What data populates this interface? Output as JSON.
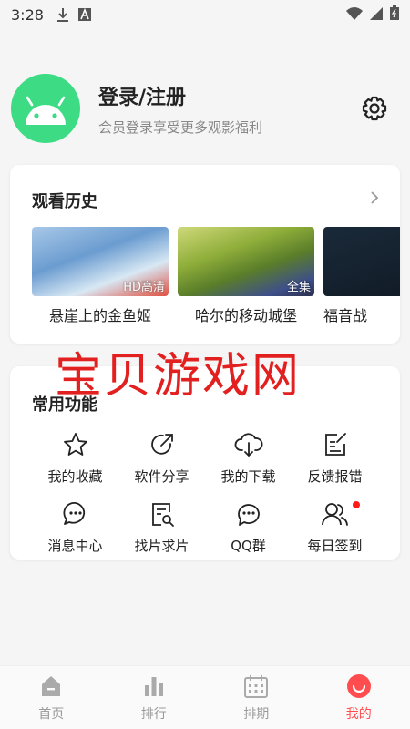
{
  "status_bar": {
    "time": "3:28"
  },
  "profile": {
    "title": "登录/注册",
    "subtitle": "会员登录享受更多观影福利"
  },
  "history": {
    "title": "观看历史",
    "items": [
      {
        "name": "悬崖上的金鱼姬",
        "badge": "HD高清"
      },
      {
        "name": "哈尔的移动城堡",
        "badge": "全集"
      },
      {
        "name": "福音战",
        "badge": ""
      }
    ]
  },
  "watermark": "宝贝游戏网",
  "functions": {
    "title": "常用功能",
    "items": [
      {
        "label": "我的收藏",
        "icon": "star-icon"
      },
      {
        "label": "软件分享",
        "icon": "share-icon"
      },
      {
        "label": "我的下载",
        "icon": "cloud-download-icon"
      },
      {
        "label": "反馈报错",
        "icon": "edit-icon"
      },
      {
        "label": "消息中心",
        "icon": "message-icon"
      },
      {
        "label": "找片求片",
        "icon": "search-document-icon"
      },
      {
        "label": "QQ群",
        "icon": "chat-icon"
      },
      {
        "label": "每日签到",
        "icon": "users-icon"
      }
    ]
  },
  "bottom_nav": {
    "items": [
      {
        "label": "首页",
        "icon": "home-icon"
      },
      {
        "label": "排行",
        "icon": "ranking-icon"
      },
      {
        "label": "排期",
        "icon": "calendar-icon"
      },
      {
        "label": "我的",
        "icon": "profile-icon"
      }
    ],
    "active_index": 3
  },
  "colors": {
    "accent": "#ff4d4f",
    "avatar_bg": "#3ddc84",
    "watermark": "#e32020"
  }
}
